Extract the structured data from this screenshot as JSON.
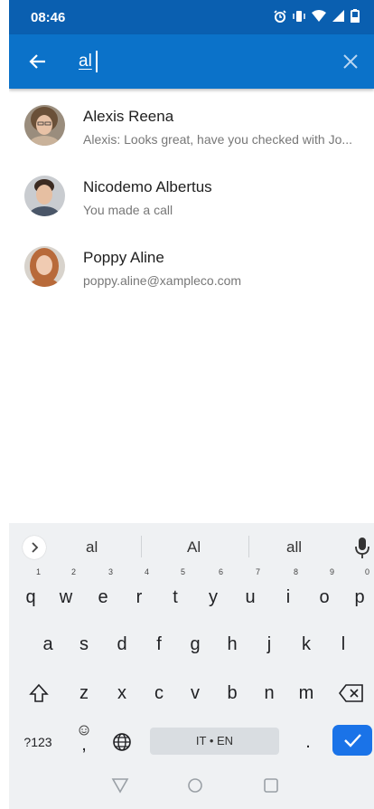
{
  "status_bar": {
    "time": "08:46"
  },
  "search": {
    "query": "al"
  },
  "results": [
    {
      "name": "Alexis Reena",
      "subtitle": "Alexis: Looks great, have you checked with Jo..."
    },
    {
      "name": "Nicodemo Albertus",
      "subtitle": "You made a call"
    },
    {
      "name": "Poppy Aline",
      "subtitle": "poppy.aline@xampleco.com"
    }
  ],
  "keyboard": {
    "suggestions": [
      "al",
      "Al",
      "all"
    ],
    "row1": [
      "q",
      "w",
      "e",
      "r",
      "t",
      "y",
      "u",
      "i",
      "o",
      "p"
    ],
    "row1_hints": [
      "1",
      "2",
      "3",
      "4",
      "5",
      "6",
      "7",
      "8",
      "9",
      "0"
    ],
    "row2": [
      "a",
      "s",
      "d",
      "f",
      "g",
      "h",
      "j",
      "k",
      "l"
    ],
    "row3": [
      "z",
      "x",
      "c",
      "v",
      "b",
      "n",
      "m"
    ],
    "symbols_label": "?123",
    "emoji_comma": ",",
    "space_label": "IT • EN",
    "period": "."
  },
  "colors": {
    "status_bar": "#0a5fb0",
    "header": "#0b72c9",
    "enter_key": "#1a73e8"
  }
}
